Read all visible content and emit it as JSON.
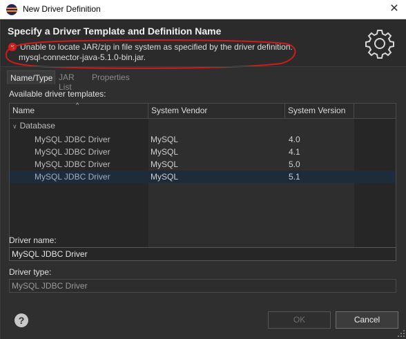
{
  "window": {
    "title": "New Driver Definition",
    "close_glyph": "✕"
  },
  "header": {
    "title": "Specify a Driver Template and Definition Name",
    "error_line1": "Unable to locate JAR/zip in file system as specified by the driver definition:",
    "error_line2": "mysql-connector-java-5.1.0-bin.jar.",
    "error_glyph": "×",
    "icon": "gear-icon",
    "annotation_color": "#d11a1a"
  },
  "tabs": [
    {
      "label": "Name/Type",
      "active": true
    },
    {
      "label": "JAR List",
      "active": false
    },
    {
      "label": "Properties",
      "active": false
    }
  ],
  "templates": {
    "label": "Available driver templates:",
    "columns": [
      "Name",
      "System Vendor",
      "System Version"
    ],
    "group": "Database",
    "rows": [
      {
        "name": "MySQL JDBC Driver",
        "vendor": "MySQL",
        "version": "4.0",
        "selected": false
      },
      {
        "name": "MySQL JDBC Driver",
        "vendor": "MySQL",
        "version": "4.1",
        "selected": false
      },
      {
        "name": "MySQL JDBC Driver",
        "vendor": "MySQL",
        "version": "5.0",
        "selected": false
      },
      {
        "name": "MySQL JDBC Driver",
        "vendor": "MySQL",
        "version": "5.1",
        "selected": true
      }
    ]
  },
  "driver_name": {
    "label": "Driver name:",
    "value": "MySQL JDBC Driver"
  },
  "driver_type": {
    "label": "Driver type:",
    "value": "MySQL JDBC Driver"
  },
  "buttons": {
    "help": "?",
    "ok": "OK",
    "cancel": "Cancel"
  }
}
